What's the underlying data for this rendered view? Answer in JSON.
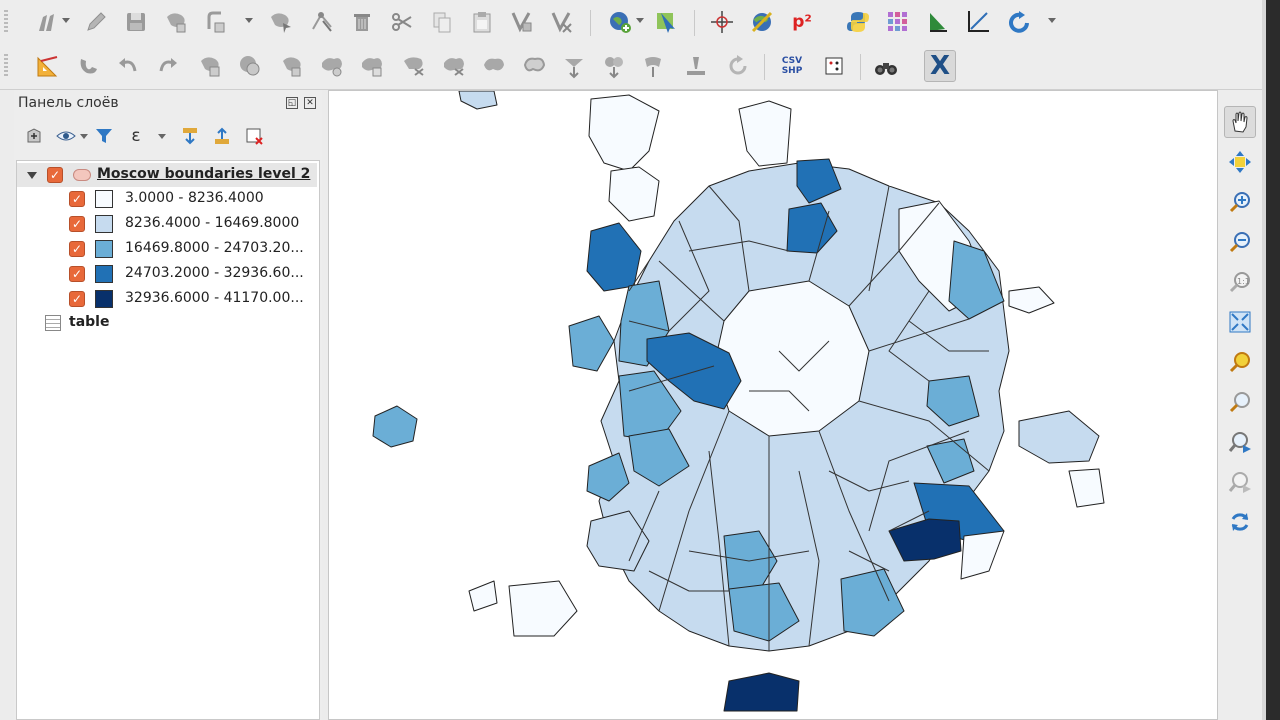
{
  "colors": {
    "class_1": "#f7fbff",
    "class_2": "#c6dbef",
    "class_3": "#6baed6",
    "class_4": "#2171b5",
    "class_5": "#08306b",
    "checkbox": "#e8693a",
    "outline": "#222222"
  },
  "toolbar_top": {
    "icons": [
      "digitize-pencil-icon",
      "edit-pencil-icon",
      "save-edits-icon",
      "add-feature-icon",
      "add-ring-icon",
      "move-feature-icon",
      "node-tool-icon",
      "delete-icon",
      "cut-icon",
      "copy-icon",
      "paste-icon",
      "select-vertex-icon",
      "deselect-icon",
      "globe-add-icon",
      "identify-icon",
      "crosshair-icon",
      "georeferencer-icon",
      "p2-icon",
      "python-icon",
      "grid-plugin-icon",
      "green-arrow-icon",
      "axis-plot-icon",
      "refresh-arrow-icon"
    ],
    "p2_label": "p²"
  },
  "toolbar_bottom": {
    "icons": [
      "measure-icon",
      "magnet-icon",
      "undo-icon",
      "redo-icon",
      "simplify-icon",
      "add-part-icon",
      "fill-ring-icon",
      "delete-ring-icon",
      "delete-part-icon",
      "reshape-icon",
      "offset-curve-icon",
      "split-icon",
      "split-parts-icon",
      "merge-icon",
      "merge-attributes-icon",
      "rotate-label-icon",
      "rotate-icon",
      "csv-shp-icon",
      "dice-icon",
      "binoculars-icon",
      "x-plugin-icon"
    ],
    "csv_label_top": "CSV",
    "csv_label_bottom": "SHP",
    "x_label": "X"
  },
  "layer_panel": {
    "title": "Панель слоёв",
    "float_glyph": "◱",
    "close_glyph": "✕",
    "tools": [
      "add-group-icon",
      "visibility-eye-icon",
      "filter-icon",
      "expression-icon",
      "expand-all-icon",
      "collapse-all-icon",
      "remove-layer-icon"
    ],
    "expression_glyph": "ε",
    "group_layer": {
      "name": "Moscow boundaries level 2",
      "classes": [
        {
          "label": "3.0000 - 8236.4000",
          "color": "#f7fbff"
        },
        {
          "label": "8236.4000 - 16469.8000",
          "color": "#c6dbef"
        },
        {
          "label": "16469.8000 - 24703.20...",
          "color": "#6baed6"
        },
        {
          "label": "24703.2000 - 32936.60...",
          "color": "#2171b5"
        },
        {
          "label": "32936.6000 - 41170.00...",
          "color": "#08306b"
        }
      ]
    },
    "table_layer": {
      "name": "table"
    },
    "check_glyph": "✓"
  },
  "nav_toolbar": {
    "icons": [
      "pan-hand-icon",
      "pan-to-selection-icon",
      "zoom-in-icon",
      "zoom-out-icon",
      "zoom-native-icon",
      "zoom-full-icon",
      "zoom-to-selection-icon",
      "zoom-to-layer-icon",
      "zoom-last-icon",
      "zoom-next-icon",
      "refresh-icon"
    ]
  }
}
